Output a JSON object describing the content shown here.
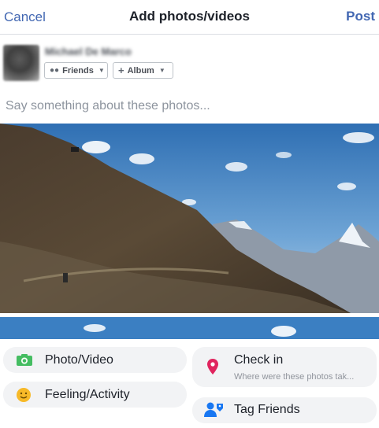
{
  "header": {
    "cancel_label": "Cancel",
    "title": "Add photos/videos",
    "post_label": "Post"
  },
  "user": {
    "name": "Michael De Marco"
  },
  "audience": {
    "privacy_label": "Friends",
    "album_label": "Album"
  },
  "composer": {
    "placeholder": "Say something about these photos..."
  },
  "actions": {
    "photo_video": "Photo/Video",
    "feeling_activity": "Feeling/Activity",
    "check_in": "Check in",
    "check_in_sub": "Where were these photos tak...",
    "tag_friends": "Tag Friends"
  },
  "colors": {
    "accent": "#4267b2",
    "photo_icon": "#45bd62",
    "feeling_icon": "#f7b928",
    "checkin_icon": "#e0245e",
    "tag_icon": "#1877f2"
  }
}
